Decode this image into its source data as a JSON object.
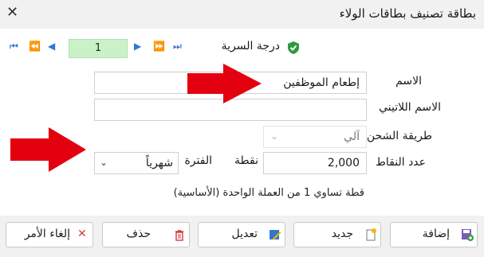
{
  "window": {
    "title": "بطاقة تصنيف بطاقات الولاء",
    "close_icon": "close-icon"
  },
  "navigator": {
    "page_value": "1"
  },
  "secrecy": {
    "label": "درجة السرية",
    "icon": "shield-check-icon",
    "icon_color": "#2e9b3e"
  },
  "form": {
    "name_label": "الاسم",
    "name_value": "إطعام الموظفين",
    "latin_name_label": "الاسم اللاتيني",
    "latin_name_value": "",
    "charge_method_label": "طريقة الشحن",
    "charge_method_value": "آلي",
    "points_count_label": "عدد النقاط",
    "points_value": "2,000",
    "point_unit_label": "نقطة",
    "period_label": "الفترة",
    "period_value": "شهرياً",
    "note": "قطة تساوي 1 من العملة الواحدة (الأساسية)"
  },
  "buttons": {
    "add": "إضافة",
    "new": "جديد",
    "edit": "تعديل",
    "delete": "حذف",
    "cancel": "إلغاء الأمر"
  },
  "colors": {
    "accent_blue": "#2f78d2",
    "page_input_bg": "#c9f2c9",
    "arrow_red": "#e3000f"
  }
}
